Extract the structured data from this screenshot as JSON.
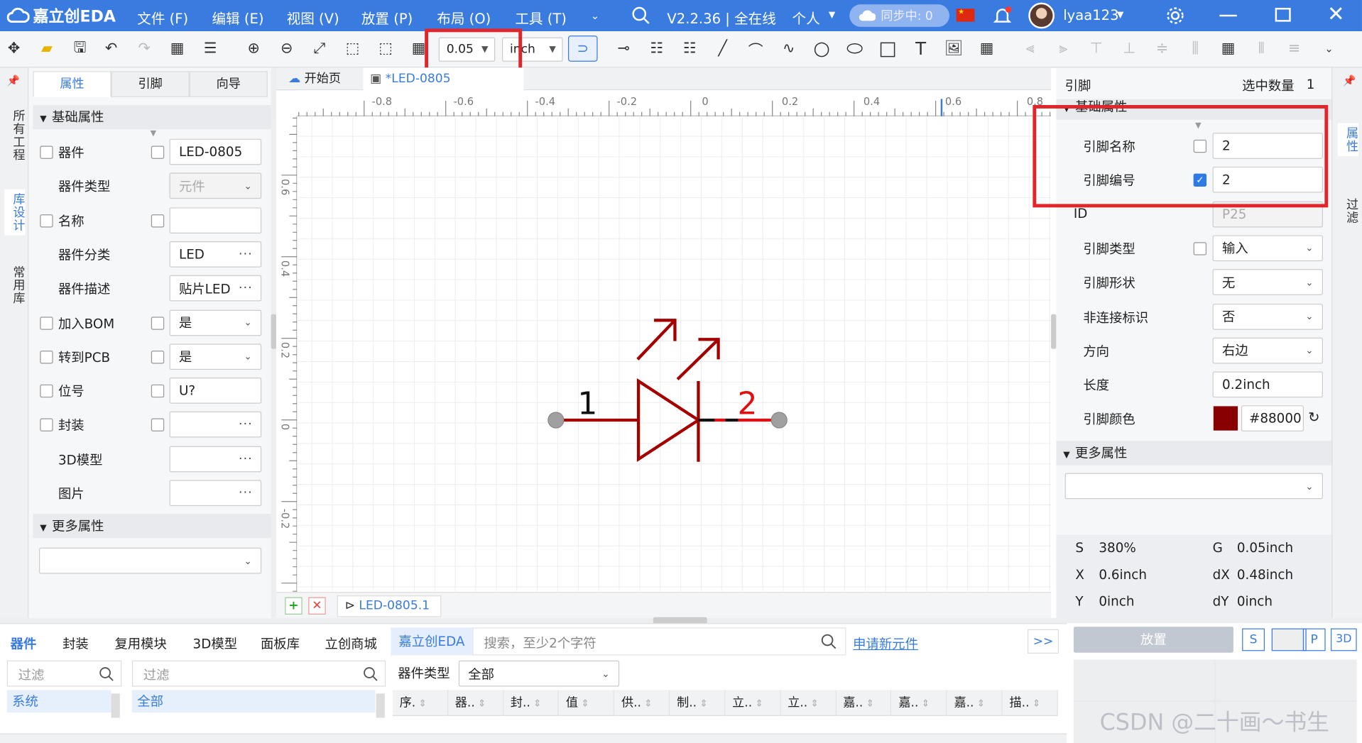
{
  "menubar": {
    "logo": "嘉立创EDA",
    "menus": [
      "文件 (F)",
      "编辑 (E)",
      "视图 (V)",
      "放置 (P)",
      "布局 (O)",
      "工具 (T)"
    ],
    "version": "V2.2.36 | 全在线",
    "personal": "个人",
    "sync": "同步中: 0",
    "username": "lyaa123",
    "accent": "#3a7be0"
  },
  "toolbar": {
    "grid_value": "0.05",
    "unit_value": "inch"
  },
  "left_rail": [
    "所有工程",
    "库设计",
    "常用库"
  ],
  "left_tabs": [
    "属性",
    "引脚",
    "向导"
  ],
  "left_panel": {
    "section_basic": "基础属性",
    "section_more": "更多属性",
    "rows": [
      {
        "label": "器件",
        "value": "LED-0805",
        "checkbox": true,
        "extra_check": true,
        "kind": "text"
      },
      {
        "label": "器件类型",
        "value": "元件",
        "checkbox": false,
        "extra_check": false,
        "kind": "select-disabled"
      },
      {
        "label": "名称",
        "value": "",
        "checkbox": true,
        "extra_check": true,
        "kind": "text"
      },
      {
        "label": "器件分类",
        "value": "LED",
        "checkbox": false,
        "extra_check": false,
        "kind": "dots"
      },
      {
        "label": "器件描述",
        "value": "贴片LED",
        "checkbox": false,
        "extra_check": false,
        "kind": "dots"
      },
      {
        "label": "加入BOM",
        "value": "是",
        "checkbox": true,
        "extra_check": true,
        "kind": "select"
      },
      {
        "label": "转到PCB",
        "value": "是",
        "checkbox": true,
        "extra_check": true,
        "kind": "select"
      },
      {
        "label": "位号",
        "value": "U?",
        "checkbox": true,
        "extra_check": true,
        "kind": "text"
      },
      {
        "label": "封装",
        "value": "",
        "checkbox": true,
        "extra_check": true,
        "kind": "dots"
      },
      {
        "label": "3D模型",
        "value": "",
        "checkbox": false,
        "extra_check": false,
        "kind": "dots"
      },
      {
        "label": "图片",
        "value": "",
        "checkbox": false,
        "extra_check": false,
        "kind": "dots"
      }
    ]
  },
  "doc_tabs": {
    "home": "开始页",
    "doc": "*LED-0805"
  },
  "ruler": {
    "top_labels": [
      "-0.8",
      "-0.6",
      "-0.4",
      "-0.2",
      "0",
      "0.2",
      "0.4",
      "0.6",
      "0.8"
    ],
    "left_labels": [
      "0.6",
      "0.4",
      "0.2",
      "0",
      "-0.2"
    ]
  },
  "schematic": {
    "pin1_number": "1",
    "pin2_number": "2",
    "body_color": "#a50000",
    "pin2_color": "#e01010"
  },
  "sheet_tab": "LED-0805.1",
  "right_panel": {
    "title": "引脚",
    "selected_label": "选中数量",
    "selected_count": "1",
    "section_basic": "基础属性",
    "section_more": "更多属性",
    "rows": [
      {
        "label": "引脚名称",
        "value": "2",
        "checked": false,
        "has_check": true,
        "kind": "text"
      },
      {
        "label": "引脚编号",
        "value": "2",
        "checked": true,
        "has_check": true,
        "kind": "text"
      },
      {
        "label": "ID",
        "value": "P25",
        "checked": false,
        "has_check": false,
        "kind": "disabled"
      },
      {
        "label": "引脚类型",
        "value": "输入",
        "checked": false,
        "has_check": true,
        "kind": "select"
      },
      {
        "label": "引脚形状",
        "value": "无",
        "checked": false,
        "has_check": false,
        "kind": "select"
      },
      {
        "label": "非连接标识",
        "value": "否",
        "checked": false,
        "has_check": false,
        "kind": "select"
      },
      {
        "label": "方向",
        "value": "右边",
        "checked": false,
        "has_check": false,
        "kind": "select"
      },
      {
        "label": "长度",
        "value": "0.2inch",
        "checked": false,
        "has_check": false,
        "kind": "text"
      },
      {
        "label": "引脚颜色",
        "value": "#88000",
        "checked": false,
        "has_check": false,
        "kind": "color"
      }
    ],
    "pin_color_swatch": "#880000",
    "status": [
      {
        "k": "S",
        "v": "380%",
        "k2": "G",
        "v2": "0.05inch"
      },
      {
        "k": "X",
        "v": "0.6inch",
        "k2": "dX",
        "v2": "0.48inch"
      },
      {
        "k": "Y",
        "v": "0inch",
        "k2": "dY",
        "v2": "0inch"
      }
    ]
  },
  "right_rail": [
    "属性",
    "过滤"
  ],
  "bottom": {
    "tabs": [
      "器件",
      "封装",
      "复用模块",
      "3D模型",
      "面板库",
      "立创商城",
      "嘉立创EDA"
    ],
    "search_placeholder": "搜索，至少2个字符",
    "apply_link": "申请新元件",
    "more_btn": ">>",
    "filter1": "过滤",
    "filter2": "过滤",
    "tree1": "系统",
    "tree2": "全部",
    "type_label": "器件类型",
    "type_value": "全部",
    "columns": [
      "序.",
      "器..",
      "封..",
      "值",
      "供..",
      "制..",
      "立..",
      "立..",
      "嘉..",
      "嘉..",
      "嘉..",
      "描.."
    ]
  },
  "bottom_right": {
    "place_btn": "放置",
    "btns": [
      "S",
      "P",
      "3D"
    ]
  },
  "watermark": "CSDN @二十画～书生"
}
